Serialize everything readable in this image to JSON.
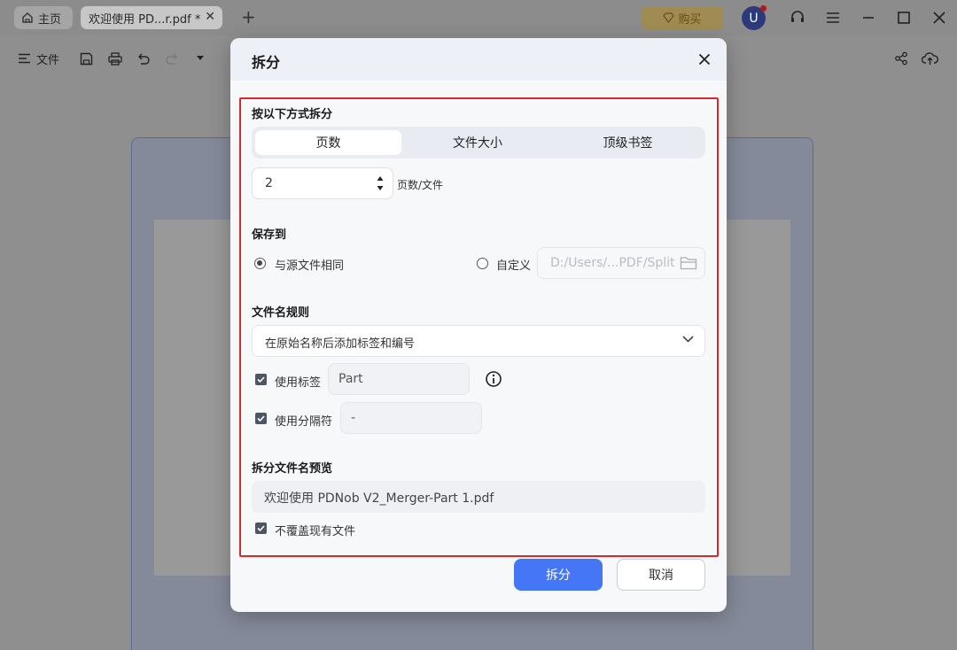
{
  "titlebar": {
    "home_tab": "主页",
    "doc_tab": "欢迎使用 PD...r.pdf *",
    "buy_label": "购买",
    "avatar_initial": "U"
  },
  "toolbar": {
    "file_label": "文件"
  },
  "dialog": {
    "title": "拆分",
    "split_section_label": "按以下方式拆分",
    "split_modes": [
      "页数",
      "文件大小",
      "顶级书签"
    ],
    "active_mode": "页数",
    "pages_value": "2",
    "pages_unit": "页数/文件",
    "save_section_label": "保存到",
    "save_same_label": "与源文件相同",
    "save_custom_label": "自定义",
    "custom_path_placeholder": "D:/Users/...PDF/Split",
    "naming_section_label": "文件名规则",
    "naming_rule": "在原始名称后添加标签和编号",
    "use_label_label": "使用标签",
    "label_value": "Part",
    "use_separator_label": "使用分隔符",
    "separator_value": "-",
    "preview_section_label": "拆分文件名预览",
    "preview_value": "欢迎使用 PDNob V2_Merger-Part 1.pdf",
    "no_overwrite_label": "不覆盖现有文件",
    "split_button": "拆分",
    "cancel_button": "取消"
  },
  "colors": {
    "primary": "#4476f6",
    "highlight_frame": "#d8282e"
  }
}
